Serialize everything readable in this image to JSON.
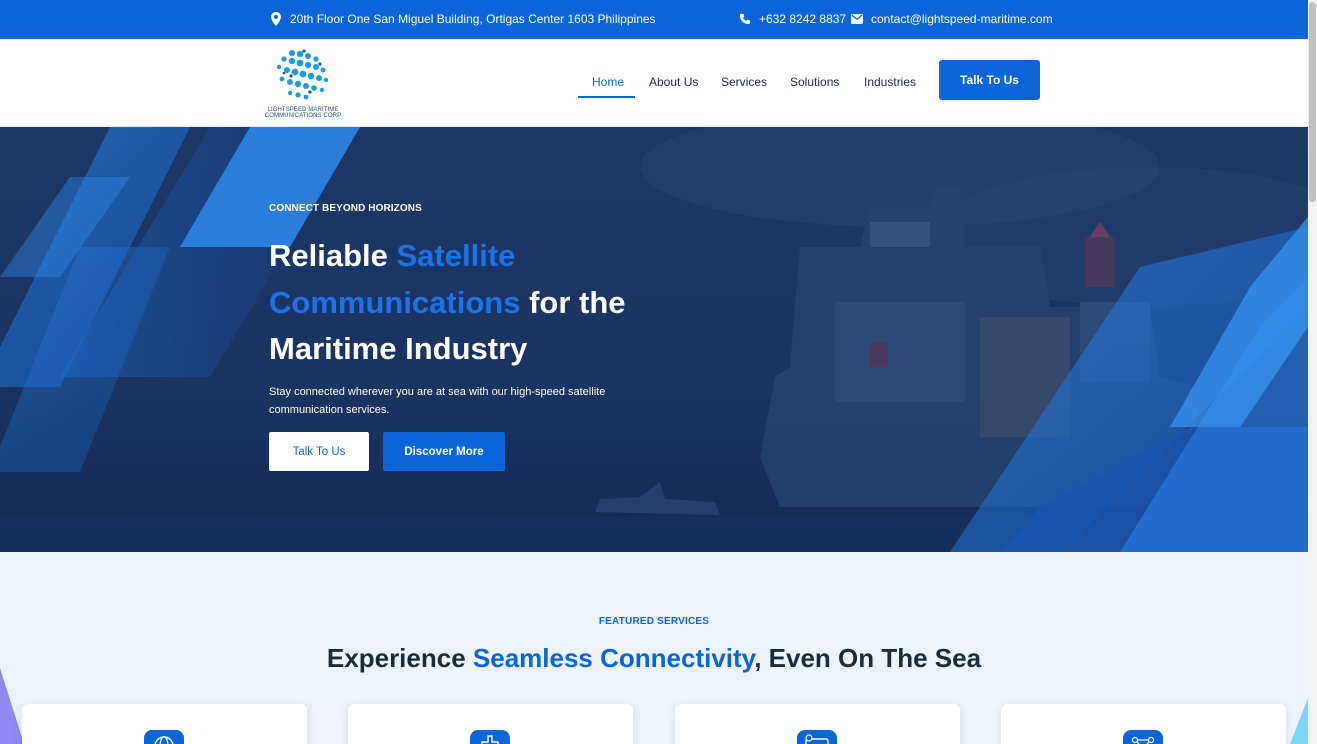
{
  "topbar": {
    "address": "20th Floor One San Miguel Building, Ortigas Center 1603 Philippines",
    "phone": "+632 8242 8837",
    "email": "contact@lightspeed-maritime.com",
    "icons": [
      "location-pin-icon",
      "phone-icon",
      "envelope-icon"
    ]
  },
  "header": {
    "logo_line1": "LIGHTSPEED MARITIME",
    "logo_line2": "COMMUNICATIONS CORP",
    "nav": [
      "Home",
      "About Us",
      "Services",
      "Solutions",
      "Industries"
    ],
    "active_nav": "Home",
    "cta": "Talk To Us"
  },
  "hero": {
    "kicker": "CONNECT BEYOND HORIZONS",
    "headline_part1": "Reliable ",
    "headline_highlight": "Satellite Communications",
    "headline_part2": " for the Maritime Industry",
    "subtext": "Stay connected wherever you are at sea with our high-speed satellite communication services.",
    "button_primary": "Talk To Us",
    "button_secondary": "Discover More"
  },
  "featured": {
    "kicker": "FEATURED SERVICES",
    "title_part1": "Experience ",
    "title_highlight": "Seamless Connectivity",
    "title_part2": ", Even On The Sea",
    "card_icons": [
      "globe-icon",
      "medical-icon",
      "card-icon",
      "network-icon"
    ]
  },
  "colors": {
    "brand_blue": "#0a66d8",
    "hero_dark": "#16305c",
    "page_bg": "#eef3f9"
  }
}
